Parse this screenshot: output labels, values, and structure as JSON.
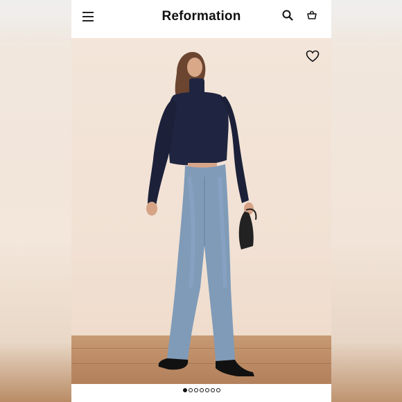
{
  "header": {
    "brand": "Reformation",
    "icons": [
      "menu-icon",
      "search-icon",
      "bag-icon"
    ]
  },
  "product_image": {
    "favorite_icon": "heart-icon",
    "description": "",
    "colors": {
      "sweater": "#1f2540",
      "jeans": "#7f9bb8",
      "background": "#f2e3d6",
      "floor": "#c1926c"
    }
  },
  "carousel": {
    "total": 7,
    "active_index": 0
  }
}
